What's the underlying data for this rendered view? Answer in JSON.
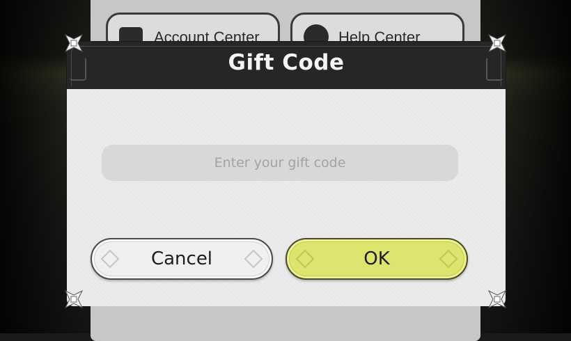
{
  "background": {
    "account_center_label": "Account Center",
    "help_center_label": "Help Center",
    "account_icon": "id-card-icon",
    "help_icon": "headset-icon"
  },
  "dialog": {
    "title": "Gift Code",
    "input": {
      "value": "",
      "placeholder": "Enter your gift code"
    },
    "buttons": {
      "cancel_label": "Cancel",
      "ok_label": "OK"
    },
    "corner_icon": "ornament-corner-icon"
  },
  "colors": {
    "header": "#262626",
    "body": "#ececec",
    "input": "#d8d8d8",
    "cancel_button": "#f0f0f0",
    "ok_button": "#dde56e"
  }
}
